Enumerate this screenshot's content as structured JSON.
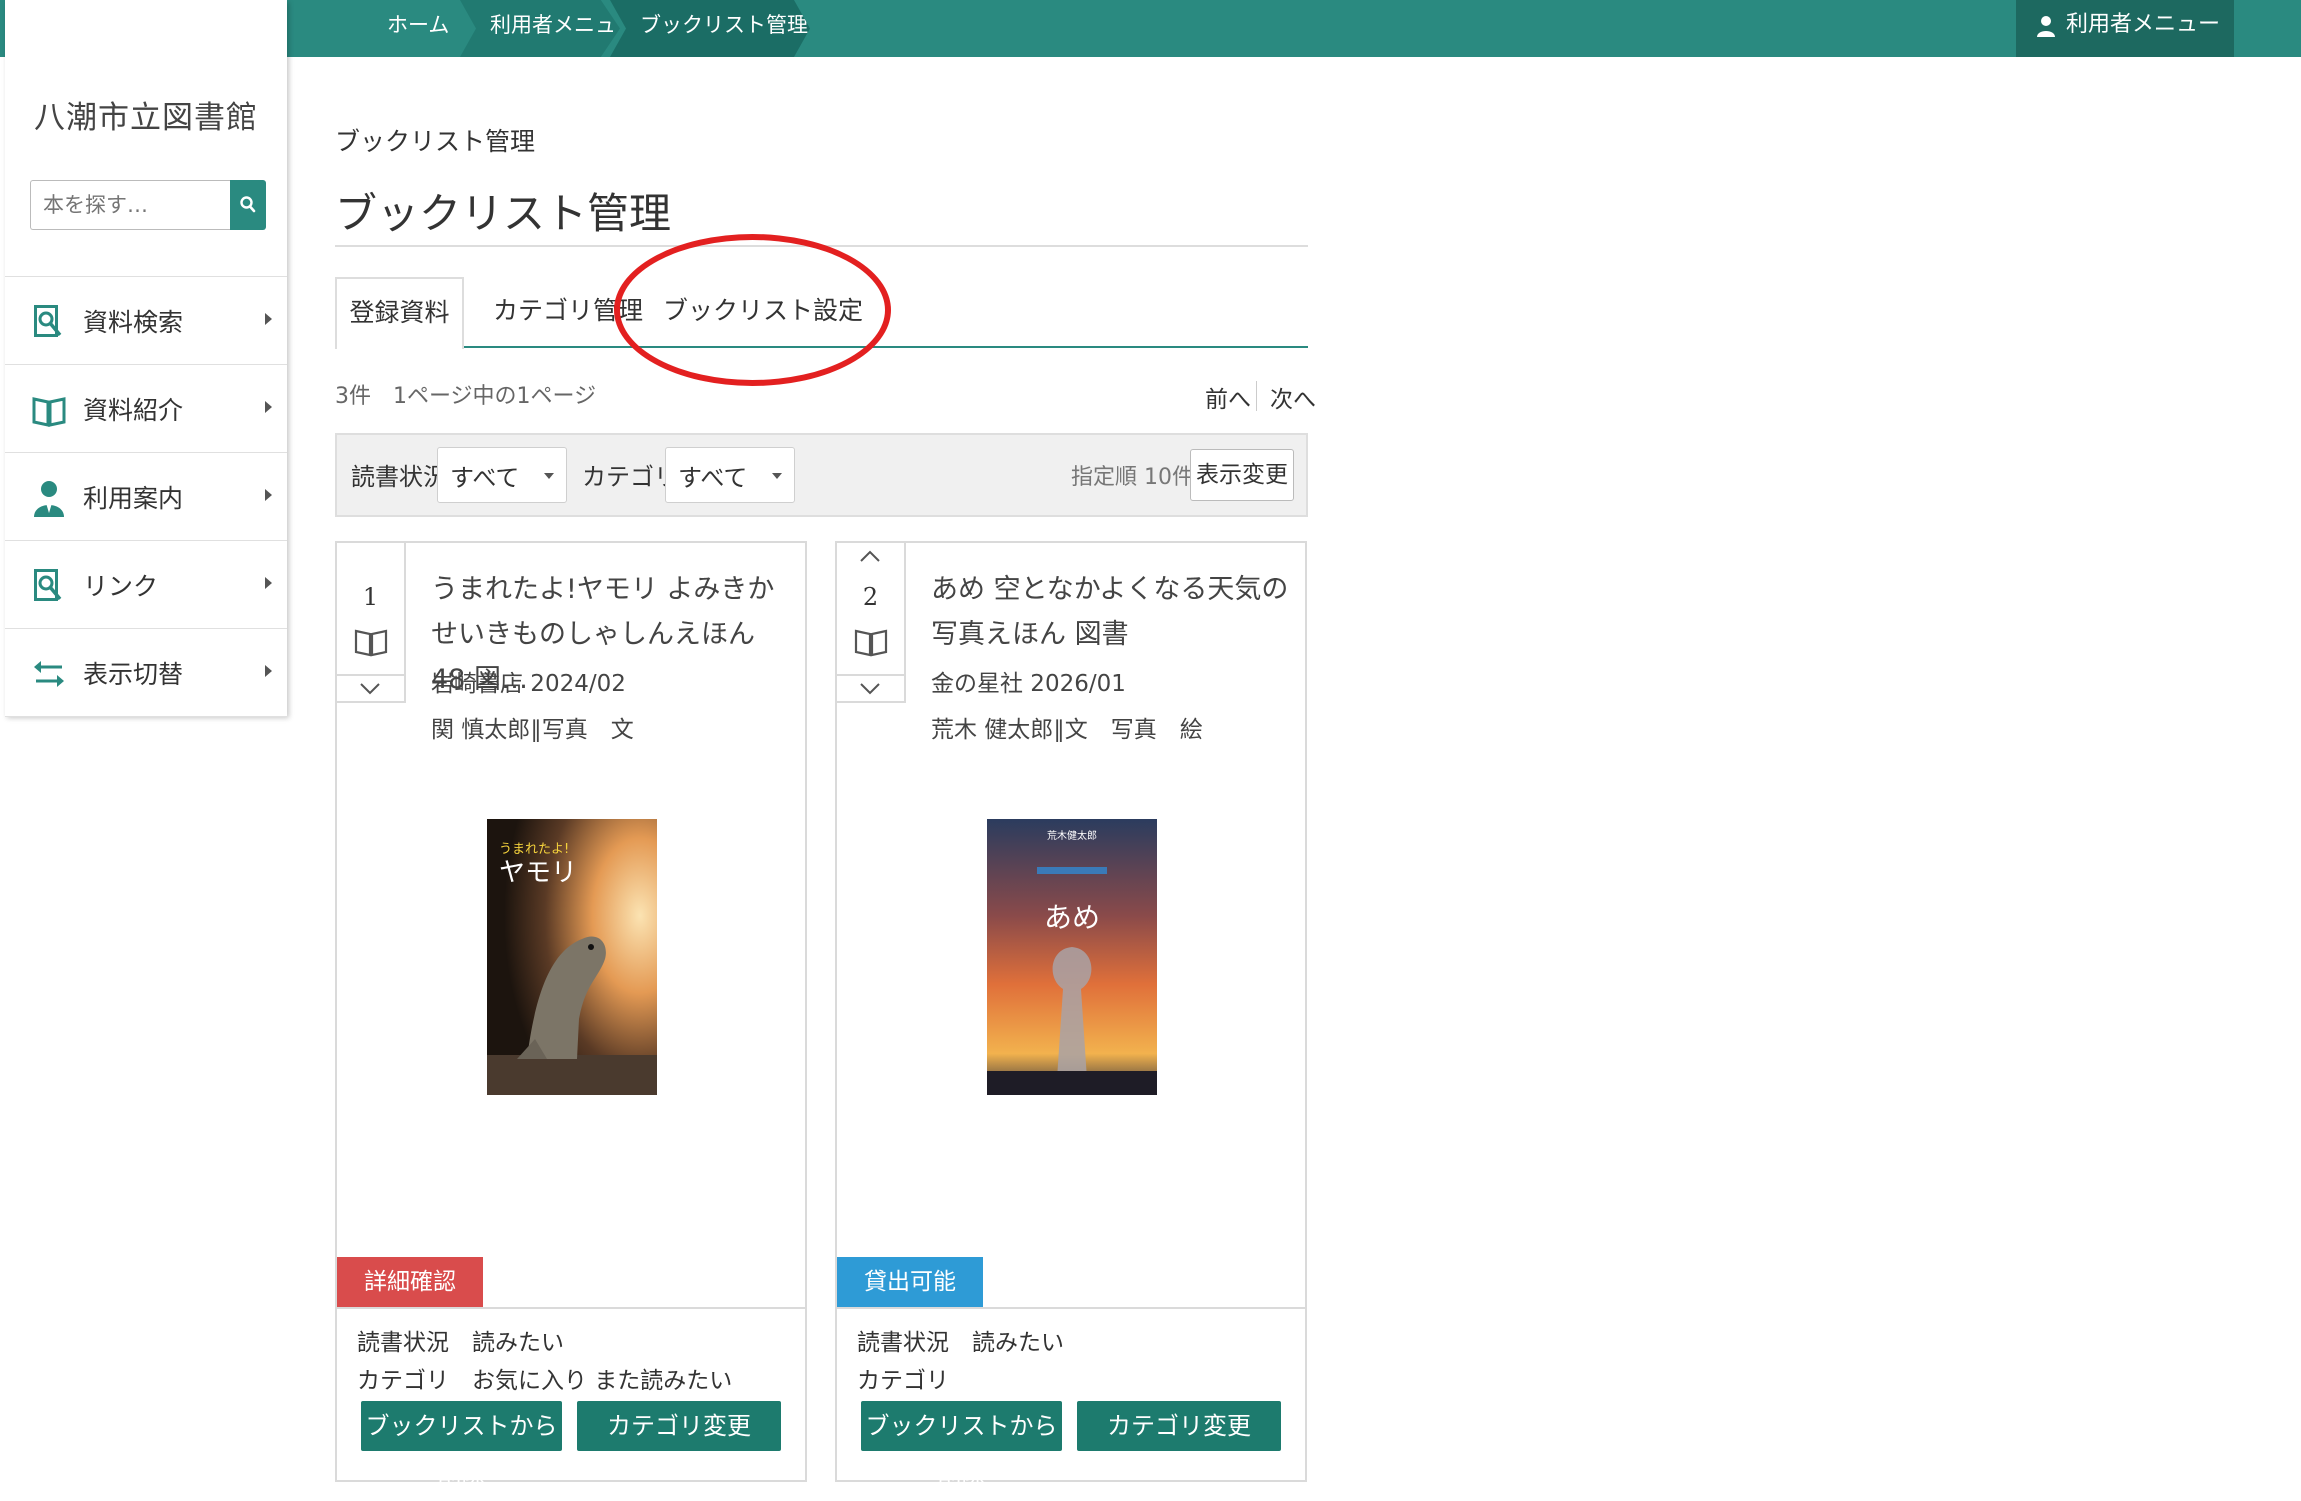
{
  "header": {
    "breadcrumb": [
      "ホーム",
      "利用者メニュー",
      "ブックリスト管理"
    ],
    "user_menu_label": "利用者メニュー"
  },
  "sidebar": {
    "library_name": "八潮市立図書館",
    "search_placeholder": "本を探す…",
    "items": [
      {
        "label": "資料検索",
        "icon": "book-search-icon"
      },
      {
        "label": "資料紹介",
        "icon": "open-book-icon"
      },
      {
        "label": "利用案内",
        "icon": "person-icon"
      },
      {
        "label": "リンク",
        "icon": "book-search-icon"
      },
      {
        "label": "表示切替",
        "icon": "swap-arrows-icon"
      }
    ]
  },
  "main": {
    "breadcrumb_small": "ブックリスト管理",
    "page_title": "ブックリスト管理",
    "tabs": [
      {
        "label": "登録資料",
        "active": true
      },
      {
        "label": "カテゴリ管理",
        "active": false
      },
      {
        "label": "ブックリスト設定",
        "active": false
      }
    ],
    "count_text": "3件　1ページ中の1ページ",
    "prev_label": "前へ",
    "next_label": "次へ",
    "filter": {
      "reading_status_label": "読書状況",
      "reading_status_value": "すべて",
      "category_label": "カテゴリ",
      "category_value": "すべて",
      "sort_text": "指定順 10件",
      "view_change_label": "表示変更"
    },
    "cards": [
      {
        "number": "1",
        "title": "うまれたよ!ヤモリ よみきかせいきものしゃしんえほん 48 図…",
        "publisher_date": "岩崎書店 2024/02",
        "author": "関 慎太郎∥写真　文",
        "status": "詳細確認",
        "status_color": "#d94c4c",
        "reading_status": "読書状況　読みたい",
        "category": "カテゴリ　お気に入り また読みたい",
        "delete_label": "ブックリストから削除",
        "category_change_label": "カテゴリ変更",
        "cover_title_small": "うまれたよ!",
        "cover_title_large": "ヤモリ"
      },
      {
        "number": "2",
        "title": "あめ 空となかよくなる天気の写真えほん 図書",
        "publisher_date": "金の星社 2026/01",
        "author": "荒木 健太郎∥文　写真　絵",
        "status": "貸出可能",
        "status_color": "#2e9bd6",
        "reading_status": "読書状況　読みたい",
        "category": "カテゴリ",
        "delete_label": "ブックリストから削除",
        "category_change_label": "カテゴリ変更",
        "cover_author": "荒木健太郎",
        "cover_title_large": "あめ"
      }
    ]
  },
  "colors": {
    "primary": "#2a8a80",
    "primary_dark": "#1d6960",
    "button": "#1d7b6e",
    "annotation_circle": "#e32020"
  }
}
